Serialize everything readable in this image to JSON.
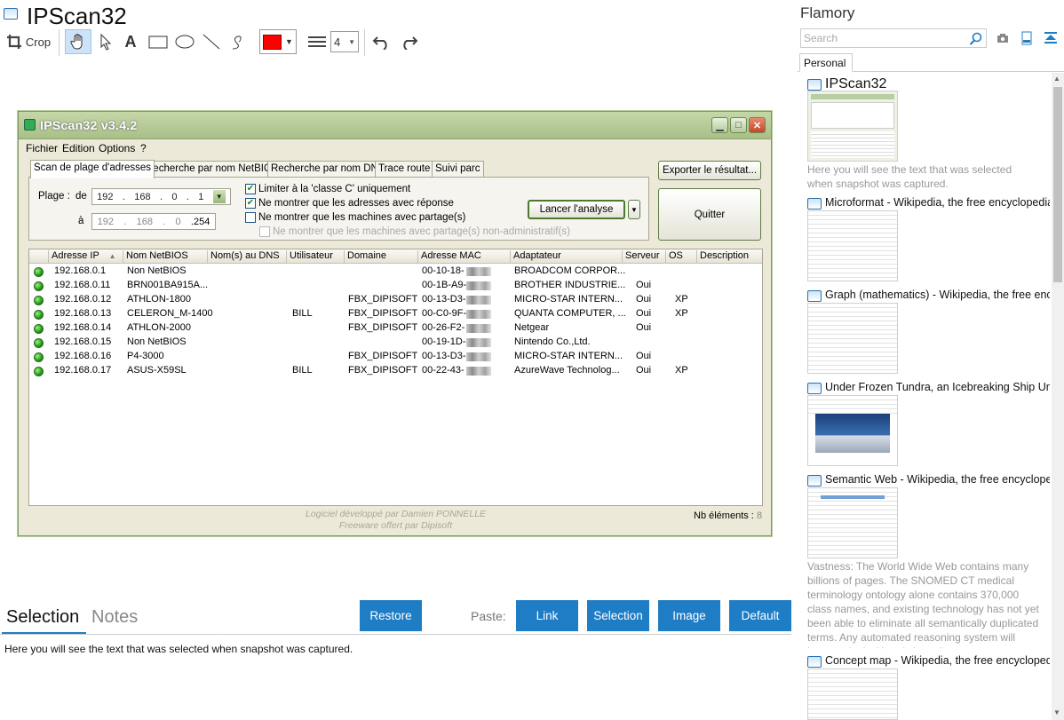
{
  "app": {
    "title": "IPScan32"
  },
  "toolbar": {
    "crop_label": "Crop",
    "pen_width": "4"
  },
  "dialog": {
    "title": "IPScan32 v3.4.2",
    "menu": [
      "Fichier",
      "Edition",
      "Options",
      "?"
    ],
    "tabs": [
      "Scan de plage d'adresses",
      "Recherche par nom NetBIOS",
      "Recherche par nom DNS",
      "Trace route",
      "Suivi parc"
    ],
    "plage_label": "Plage :",
    "de_label": "de",
    "a_label": "à",
    "ip_from": [
      "192",
      "168",
      "0",
      "1"
    ],
    "ip_to": [
      "192",
      "168",
      "0",
      ".254"
    ],
    "checks": [
      {
        "label": "Limiter à la 'classe C' uniquement",
        "checked": true
      },
      {
        "label": "Ne montrer que les adresses avec réponse",
        "checked": true
      },
      {
        "label": "Ne montrer que les machines avec partage(s)",
        "checked": false
      },
      {
        "label": "Ne montrer que les machines avec partage(s) non-administratif(s)",
        "checked": false
      }
    ],
    "launch_button": "Lancer l'analyse",
    "export_button": "Exporter le résultat...",
    "quit_button": "Quitter",
    "columns": [
      "Adresse IP",
      "Nom NetBIOS",
      "Nom(s) au DNS",
      "Utilisateur",
      "Domaine",
      "Adresse MAC",
      "Adaptateur",
      "Serveur",
      "OS",
      "Description"
    ],
    "rows": [
      {
        "ip": "192.168.0.1",
        "netbios": "Non NetBIOS",
        "user": "",
        "domain": "",
        "mac": "00-10-18-",
        "adapter": "BROADCOM CORPOR...",
        "server": "",
        "os": ""
      },
      {
        "ip": "192.168.0.11",
        "netbios": "BRN001BA915A...",
        "user": "",
        "domain": "",
        "mac": "00-1B-A9-",
        "adapter": "BROTHER INDUSTRIE...",
        "server": "Oui",
        "os": ""
      },
      {
        "ip": "192.168.0.12",
        "netbios": "ATHLON-1800",
        "user": "",
        "domain": "FBX_DIPISOFT",
        "mac": "00-13-D3-",
        "adapter": "MICRO-STAR INTERN...",
        "server": "Oui",
        "os": "XP"
      },
      {
        "ip": "192.168.0.13",
        "netbios": "CELERON_M-1400",
        "user": "BILL",
        "domain": "FBX_DIPISOFT",
        "mac": "00-C0-9F-",
        "adapter": "QUANTA COMPUTER, ...",
        "server": "Oui",
        "os": "XP"
      },
      {
        "ip": "192.168.0.14",
        "netbios": "ATHLON-2000",
        "user": "",
        "domain": "FBX_DIPISOFT",
        "mac": "00-26-F2-",
        "adapter": "Netgear",
        "server": "Oui",
        "os": ""
      },
      {
        "ip": "192.168.0.15",
        "netbios": "Non NetBIOS",
        "user": "",
        "domain": "",
        "mac": "00-19-1D-",
        "adapter": "Nintendo Co.,Ltd.",
        "server": "",
        "os": ""
      },
      {
        "ip": "192.168.0.16",
        "netbios": "P4-3000",
        "user": "",
        "domain": "FBX_DIPISOFT",
        "mac": "00-13-D3-",
        "adapter": "MICRO-STAR INTERN...",
        "server": "Oui",
        "os": ""
      },
      {
        "ip": "192.168.0.17",
        "netbios": "ASUS-X59SL",
        "user": "BILL",
        "domain": "FBX_DIPISOFT",
        "mac": "00-22-43-",
        "adapter": "AzureWave Technolog...",
        "server": "Oui",
        "os": "XP"
      }
    ],
    "footer_line1": "Logiciel développé par Damien PONNELLE",
    "footer_line2": "Freeware offert par Dipisoft",
    "nb_label": "Nb éléments :",
    "nb_value": "8"
  },
  "bottom": {
    "tab_selection": "Selection",
    "tab_notes": "Notes",
    "restore": "Restore",
    "paste_label": "Paste:",
    "link": "Link",
    "selection": "Selection",
    "image": "Image",
    "default": "Default",
    "text": "Here you will see the text that was selected when snapshot was captured."
  },
  "sidebar": {
    "title": "Flamory",
    "search_placeholder": "Search",
    "tab": "Personal",
    "items": [
      {
        "title": "IPScan32",
        "desc": "Here you will see the text that was selected when snapshot was captured."
      },
      {
        "title": "Microformat - Wikipedia, the free encyclopedia",
        "desc": ""
      },
      {
        "title": "Graph (mathematics) - Wikipedia, the free encyclopedia",
        "desc": ""
      },
      {
        "title": "Under Frozen Tundra, an Icebreaking Ship Uncovers",
        "desc": ""
      },
      {
        "title": "Semantic Web - Wikipedia, the free encyclopedia",
        "desc": "Vastness: The World Wide Web contains many billions of pages. The SNOMED CT medical terminology ontology alone contains 370,000 class names, and existing technology has not yet been able to eliminate all semantically duplicated terms. Any automated reasoning system will have to deal with truly huge inputs."
      },
      {
        "title": "Concept map - Wikipedia, the free encyclopedia",
        "desc": ""
      }
    ]
  },
  "colors": {
    "accent": "#1f7dc6",
    "pen": "#ff0000"
  }
}
